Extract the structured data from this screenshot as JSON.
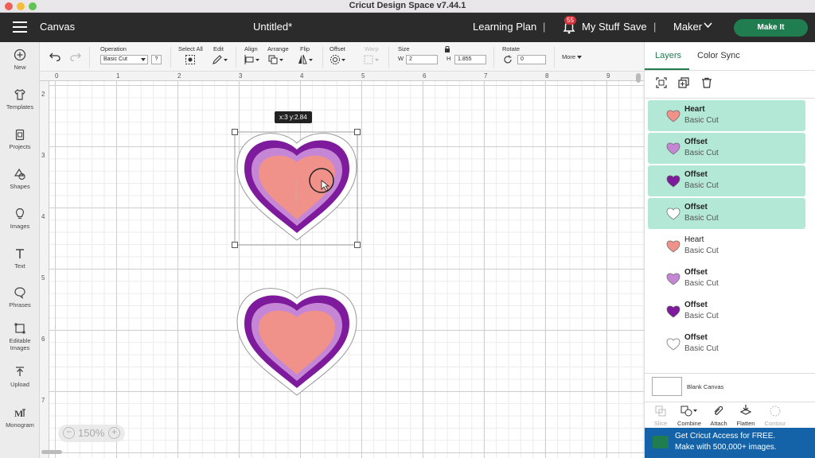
{
  "window": {
    "title": "Cricut Design Space  v7.44.1"
  },
  "colors": {
    "brand_green": "#1f7d4f",
    "header_bg": "#2b2b2b",
    "selection_bg": "#b3e8d6",
    "heart_pink": "#f0918a",
    "offset_light": "#c686d6",
    "offset_dark": "#7e1a9c",
    "promo_blue": "#1463a8"
  },
  "header": {
    "menu_icon": "hamburger-icon",
    "section": "Canvas",
    "doc_title": "Untitled*",
    "learning_plan": "Learning Plan",
    "sep": "|",
    "notif_count": "55",
    "my_stuff": "My Stuff",
    "save": "Save",
    "machine": "Maker",
    "make_it": "Make It"
  },
  "leftbar": [
    {
      "label": "New",
      "icon": "plus-circle-icon"
    },
    {
      "label": "Templates",
      "icon": "shirt-icon"
    },
    {
      "label": "Projects",
      "icon": "clipboard-icon"
    },
    {
      "label": "Shapes",
      "icon": "shapes-icon"
    },
    {
      "label": "Images",
      "icon": "bulb-icon"
    },
    {
      "label": "Text",
      "icon": "text-icon"
    },
    {
      "label": "Phrases",
      "icon": "speech-bubble-icon"
    },
    {
      "label": "Editable Images",
      "icon": "editable-image-icon"
    },
    {
      "label": "Upload",
      "icon": "upload-icon"
    },
    {
      "label": "Monogram",
      "icon": "monogram-icon"
    }
  ],
  "toolbar": {
    "operation_label": "Operation",
    "operation_value": "Basic Cut",
    "help": "?",
    "select_all": "Select All",
    "edit": "Edit",
    "align": "Align",
    "arrange": "Arrange",
    "flip": "Flip",
    "offset": "Offset",
    "warp": "Warp",
    "size_label": "Size",
    "w_label": "W",
    "w_value": "2",
    "h_label": "H",
    "h_value": "1.855",
    "rotate_label": "Rotate",
    "rotate_value": "0",
    "more": "More"
  },
  "canvas": {
    "ruler_top": [
      "0",
      "1",
      "2",
      "3",
      "4",
      "5",
      "6",
      "7",
      "8",
      "9"
    ],
    "ruler_left": [
      "2",
      "3",
      "4",
      "5",
      "6",
      "7"
    ],
    "tooltip": "x:3 y:2.84",
    "zoom": "150%",
    "zoom_minus": "−",
    "zoom_plus": "+"
  },
  "rightpanel": {
    "tab_layers": "Layers",
    "tab_color_sync": "Color Sync",
    "layers": [
      {
        "name": "Heart",
        "op": "Basic Cut",
        "selected": true,
        "color": "#f0918a"
      },
      {
        "name": "Offset",
        "op": "Basic Cut",
        "selected": true,
        "color": "#c686d6"
      },
      {
        "name": "Offset",
        "op": "Basic Cut",
        "selected": true,
        "color": "#7e1a9c"
      },
      {
        "name": "Offset",
        "op": "Basic Cut",
        "selected": true,
        "color": "#ffffff"
      },
      {
        "name": "Heart",
        "op": "Basic Cut",
        "selected": false,
        "color": "#f0918a"
      },
      {
        "name": "Offset",
        "op": "Basic Cut",
        "selected": false,
        "color": "#c686d6"
      },
      {
        "name": "Offset",
        "op": "Basic Cut",
        "selected": false,
        "color": "#7e1a9c"
      },
      {
        "name": "Offset",
        "op": "Basic Cut",
        "selected": false,
        "color": "#ffffff"
      }
    ],
    "blank_canvas": "Blank Canvas",
    "tools": [
      {
        "label": "Slice",
        "disabled": true
      },
      {
        "label": "Combine",
        "disabled": false
      },
      {
        "label": "Attach",
        "disabled": false
      },
      {
        "label": "Flatten",
        "disabled": false
      },
      {
        "label": "Contour",
        "disabled": true
      }
    ],
    "promo_line1": "Get Cricut Access for FREE.",
    "promo_line2": "Make with 500,000+ images."
  }
}
